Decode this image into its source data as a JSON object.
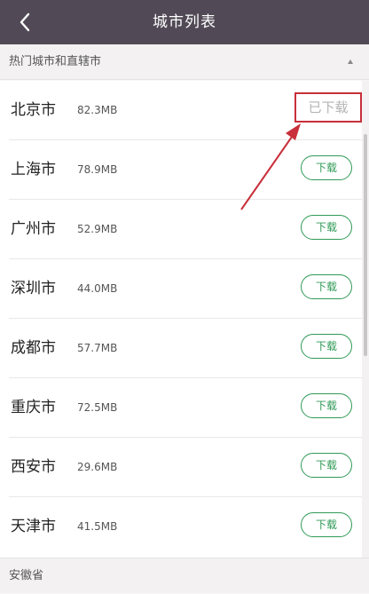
{
  "header": {
    "title": "城市列表",
    "back_icon": "chevron-left-icon"
  },
  "sections": [
    {
      "label": "热门城市和直辖市",
      "collapse_icon": "caret-up-icon"
    },
    {
      "label": "安徽省"
    }
  ],
  "cities": [
    {
      "name": "北京市",
      "size": "82.3MB",
      "status": "已下载"
    },
    {
      "name": "上海市",
      "size": "78.9MB",
      "status": "下载"
    },
    {
      "name": "广州市",
      "size": "52.9MB",
      "status": "下载"
    },
    {
      "name": "深圳市",
      "size": "44.0MB",
      "status": "下载"
    },
    {
      "name": "成都市",
      "size": "57.7MB",
      "status": "下载"
    },
    {
      "name": "重庆市",
      "size": "72.5MB",
      "status": "下载"
    },
    {
      "name": "西安市",
      "size": "29.6MB",
      "status": "下载"
    },
    {
      "name": "天津市",
      "size": "41.5MB",
      "status": "下载"
    }
  ],
  "colors": {
    "header_bg": "#514a56",
    "accent_green": "#2f9a56",
    "annotation_red": "#c82f3a"
  }
}
